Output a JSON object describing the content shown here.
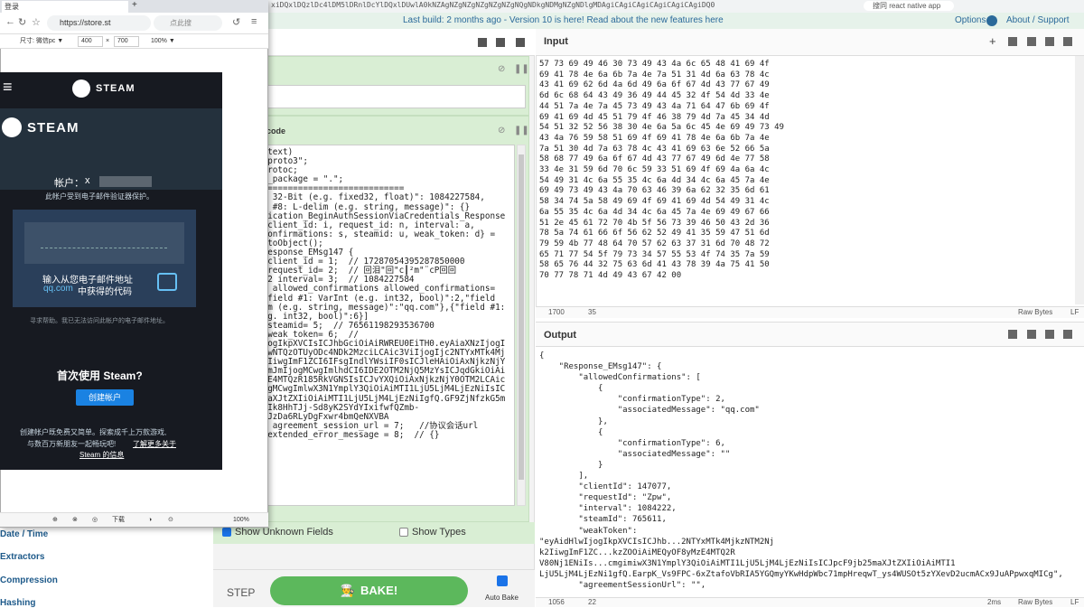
{
  "banner": {
    "message": "Last build: 2 months ago - Version 10 is here! Read about the new features here",
    "options": "Options",
    "about": "About / Support",
    "topbar_fragment": "xiDQxlDQzlDc4lDM5lDRnlDcYlDQxlDUwlA0kNZAgNZgNZgNZgNZgNZgNQgNDkgNDMgNZgNDlgMDAgiCAgiCAgiCAgiCAgiCAgiDQ0",
    "search_fragment": "搜同 react native app"
  },
  "input": {
    "title": "Input",
    "hex_lines": [
      "57 73 69 49 46 30 73 49 43 4a 6c 65 48 41 69 4f",
      "69 41 78 4e 6a 6b 7a 4e 7a 51 31 4d 6a 63 78 4c",
      "43 41 69 62 6d 4a 6d 49 6a 6f 67 4d 43 77 67 49",
      "6d 6c 68 64 43 49 36 49 44 45 32 4f 54 4d 33 4e",
      "44 51 7a 4e 7a 45 73 49 43 4a 71 64 47 6b 69 4f",
      "69 41 69 4d 45 51 79 4f 46 38 79 4d 7a 45 34 4d",
      "54 51 32 52 56 38 30 4e 6a 5a 6c 45 4e 69 49 73 49",
      "43 4a 76 59 58 51 69 4f 69 41 78 4e 6a 6b 7a 4e",
      "7a 51 30 4d 7a 63 78 4c 43 41 69 63 6e 52 66 5a",
      "58 68 77 49 6a 6f 67 4d 43 77 67 49 6d 4e 77 58",
      "33 4e 31 59 6d 70 6c 59 33 51 69 4f 69 4a 6a 4c",
      "54 49 31 4c 6a 55 35 4c 6a 4d 34 4c 6a 45 7a 4e",
      "69 49 73 49 43 4a 70 63 46 39 6a 62 32 35 6d 61",
      "58 34 74 5a 58 49 69 4f 69 41 69 4d 54 49 31 4c",
      "6a 55 35 4c 6a 4d 34 4c 6a 45 7a 4e 69 49 67 66",
      "51 2e 45 61 72 70 4b 5f 56 73 39 46 50 43 2d 36",
      "78 5a 74 61 66 6f 56 62 52 49 41 35 59 47 51 6d",
      "79 59 4b 77 48 64 70 57 62 63 37 31 6d 70 48 72",
      "65 71 77 54 5f 79 73 34 57 55 53 4f 74 35 7a 59",
      "58 65 76 44 32 75 63 6d 41 43 78 39 4a 75 41 50",
      "70 77 78 71 4d 49 43 67 42 00"
    ],
    "status_left": "1700",
    "status_mid": "35",
    "status_right": "Raw Bytes",
    "status_eol": "LF"
  },
  "output": {
    "title": "Output",
    "json_lines": [
      "{",
      "    \"Response_EMsg147\": {",
      "        \"allowedConfirmations\": [",
      "            {",
      "                \"confirmationType\": 2,",
      "                \"associatedMessage\": \"qq.com\"",
      "            },",
      "            {",
      "                \"confirmationType\": 6,",
      "                \"associatedMessage\": \"\"",
      "            }",
      "        ],",
      "        \"clientId\": 147077,",
      "        \"requestId\": \"Zpw\",",
      "        \"interval\": 1084222,",
      "        \"steamId\": 765611,",
      "        \"weakToken\":",
      "\"eyAidHlwIjogIkpXVCIsICJhb...2NTYxMTk4MjkzNTM2Nj",
      "k2IiwgImF1ZC...kzZOOiAiMEQyOF8yMzE4MTQ2R",
      "V80Nj1ENiIs...cmgimiwX3N1YmplY3QiOiAiMTI1LjU5LjM4LjEzNiIsICJpcF9jb25maXJtZXIiOiAiMTI1",
      "LjU5LjM4LjEzNi1gfQ.EarpK_Vs9FPC-6xZtafoVbRIA5YGQmyYKwHdpWbc71mpHreqwT_ys4WUSOt5zYXevD2ucmACx9JuAPpwxqMICg\",",
      "        \"agreementSessionUrl\": \"\","
    ],
    "status_left": "1056",
    "status_mid": "22",
    "status_time": "2ms",
    "status_right": "Raw Bytes",
    "status_eol": "LF"
  },
  "recipe": {
    "op2_title": "code",
    "proto_lines": [
      "o text)",
      " \"proto3\";",
      " Protoc;",
      " o_package = \".\";",
      "",
      "=============================",
      "",
      "3: 32-Bit (e.g. fixed32, float)\": 1084227584,",
      "ld #8: L-delim (e.g. string, message)\": {}",
      "",
      "",
      "ntication_BeginAuthSessionViaCredentials_Response",
      " {client_id: i, request_id: n, interval: a,",
      " confirmations: s, steamid: u, weak_token: d} =",
      " .toObject();",
      " Response_EMsg147 {",
      "  client_id = 1;  // 17287054395287850000",
      "  request_id= 2;  // 回泪\"回\"c┃²m\"¨cP回回",
      "  2 interval= 3;  // 1084227584",
      "ed allowed_confirmations allowed_confirmations=",
      "{\"field #1: VarInt (e.g. int32, bool)\":2,\"field",
      "lim (e.g. string, message)\":\"qq.com\"},{\"field #1:",
      "e.g. int32, bool)\":6}]",
      "  steamid= 5;  // 76561198293536700",
      "  weak_token= 6;  //",
      "TjogIkpXVCIsICJhbGciOiAiRWREU0EiTH0.eyAiaXNzIjogI",
      "DcwNTQzOTUyODc4NDk2MzciLCAic3ViIjogIjc2NTYxMTk4Mj",
      "k2IiwgImF1ZCI6IFsgIndlYWsiIF0sICJleHAiOiAxNjkzNjY",
      "ibmJmIjogMCwgImlhdCI6IDE2OTM2NjQ5MzYsICJqdGkiOiAi",
      "MzE4MTQzR185RkVGNSIsICJvYXQiOiAxNjkzNjY0OTM2LCAic",
      "jogMCwgImlwX3N1YmplY3QiOiAiMTI1LjU5LjM4LjEzNiIsIC",
      "5maXJtZXIiOiAiMTI1LjU5LjM4LjEzNiIgfQ.GF9ZjNfzkG5m",
      "b1Ik8HhTJj-Sd8yK2SYdYIxifwfQZmb-",
      "U9JzDa6RLyDgFxwr4bmQeNXVBA",
      "   agreement_session_url = 7;   //协议会话url",
      "  extended_error_message = 8;  // {}"
    ],
    "show_unknown": "Show Unknown Fields",
    "show_types": "Show Types",
    "step": "STEP",
    "bake": "BAKE!",
    "auto_bake": "Auto Bake"
  },
  "ops_list": [
    "Date / Time",
    "Extractors",
    "Compression",
    "Hashing"
  ],
  "browser": {
    "tab_title": "登录",
    "url": "https://store.st",
    "search_placeholder": "点此搜",
    "dev_size": "尺寸: 微信pc ▼",
    "dev_w": "400",
    "dev_x": "×",
    "dev_h": "700",
    "dev_zoom": "100% ▼",
    "zoom": "100%",
    "status_items": [
      "下载",
      "⊕",
      "⊗",
      "◎",
      "◑",
      "⊙"
    ]
  },
  "steam": {
    "logo_text": "STEAM",
    "brand": "STEAM",
    "account_label": "帐户：",
    "account_value": "x",
    "protect_notice": "此帐户受到电子邮件验证器保护。",
    "enter_code_line1": "输入从您电子邮件地址",
    "enter_code_email": "qq.com",
    "enter_code_line2": "中获得的代码",
    "help_text": "寻求帮助。我已无法访问此帐户的电子邮件地址。",
    "first_time": "首次使用 Steam?",
    "create_account": "创建帐户",
    "promo_line1": "创建帐户既免费又简单。探索成千上万款游戏,",
    "promo_line2": "与数百万新朋友一起畅玩吧!",
    "promo_link": "了解更多关于",
    "promo_link2": "Steam 的信息"
  }
}
